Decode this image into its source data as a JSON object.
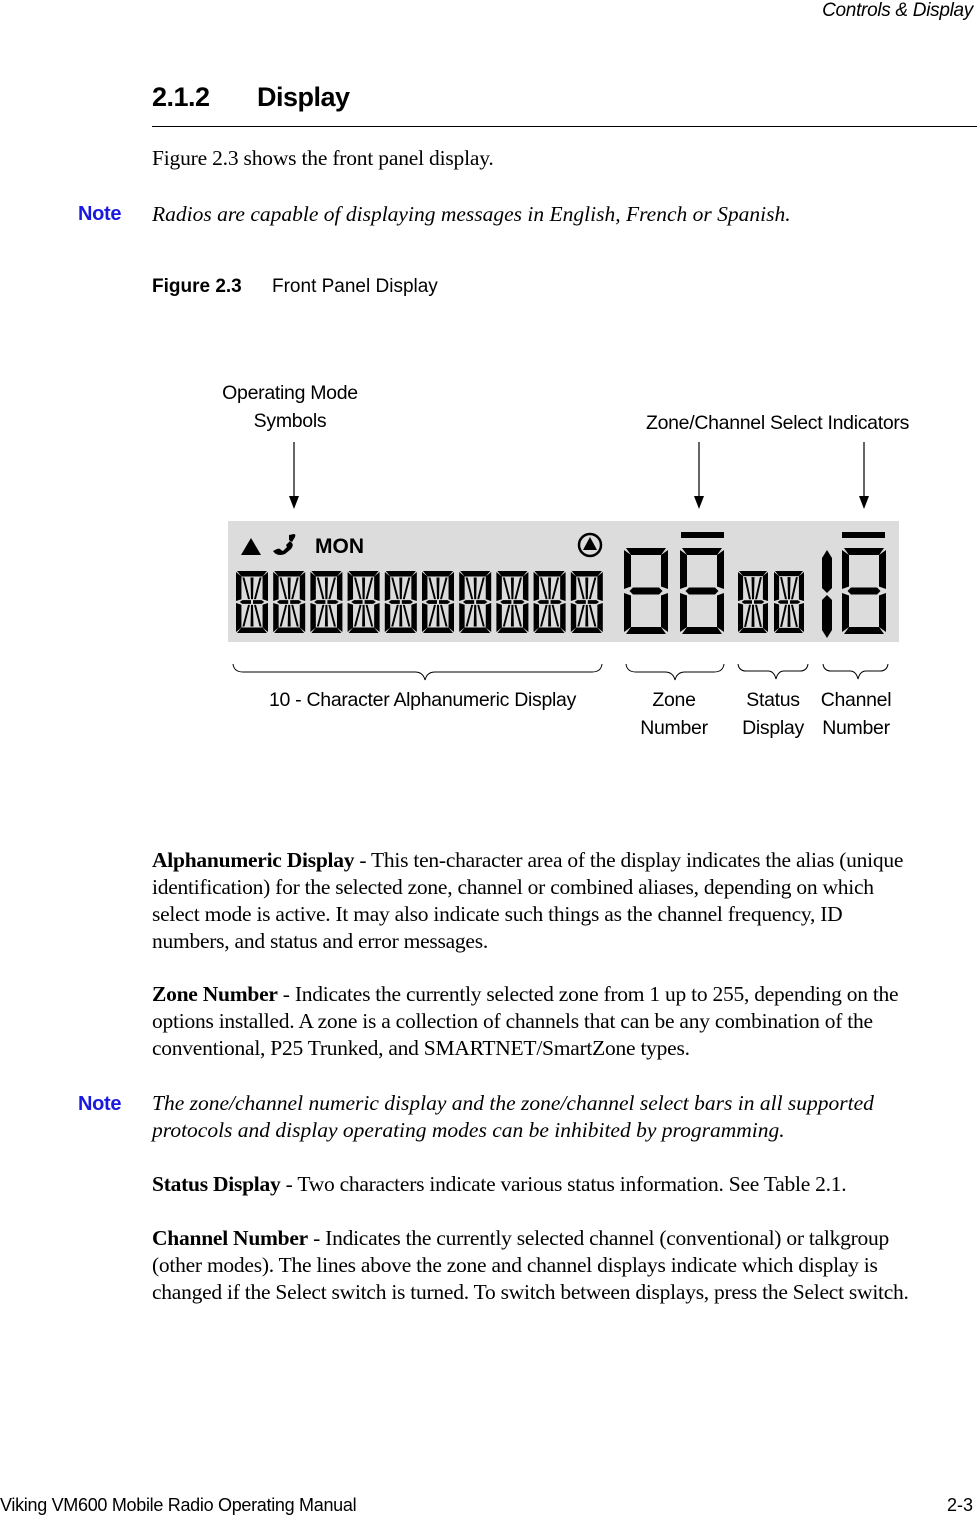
{
  "header": {
    "running_title": "Controls & Display"
  },
  "section": {
    "number": "2.1.2",
    "title": "Display"
  },
  "intro": "Figure 2.3 shows the front panel display.",
  "notes": [
    {
      "label": "Note",
      "text": "Radios are capable of displaying messages in English, French or Spanish."
    },
    {
      "label": "Note",
      "text_lines": [
        "The zone/channel numeric display and the zone/channel select bars in all supported",
        "protocols and display operating modes can be inhibited by programming."
      ]
    }
  ],
  "figure": {
    "number": "Figure 2.3",
    "title": "Front Panel Display",
    "callouts_top": {
      "operating_mode": [
        "Operating Mode",
        "Symbols"
      ],
      "zone_channel_select": "Zone/Channel Select Indicators"
    },
    "lcd": {
      "symbols": [
        {
          "name": "triangle-up-icon",
          "glyph": "▲"
        },
        {
          "name": "phone-icon",
          "glyph": "phone"
        },
        {
          "name": "mon-text",
          "glyph": "MON"
        },
        {
          "name": "circle-triangle-icon",
          "glyph": "circle-triangle"
        }
      ],
      "alphanumeric_chars": 10,
      "zone_digits": 2,
      "status_chars": 2,
      "channel_digits": "1 + full digit",
      "select_bars": [
        "zone",
        "channel"
      ],
      "background_color": "#dcdcdc",
      "segment_color": "#000000"
    },
    "callouts_bottom": {
      "alphanumeric": "10 - Character Alphanumeric Display",
      "zone": [
        "Zone",
        "Number"
      ],
      "status": [
        "Status",
        "Display"
      ],
      "channel": [
        "Channel",
        "Number"
      ]
    }
  },
  "paragraphs": {
    "alphanumeric": {
      "term": "Alphanumeric Display",
      "sep": " - ",
      "lines": [
        "This ten-character area of the display indicates the alias (unique",
        "identification) for the selected zone, channel or combined aliases, depending on which",
        "select mode is active. It may also indicate such things as the channel frequency, ID",
        "numbers, and status and error messages."
      ]
    },
    "zone": {
      "term": "Zone Number",
      "sep": " - ",
      "lines": [
        "Indicates the currently selected zone from 1 up to 255, depending on the",
        "options installed. A zone is a collection of channels that can be any combination of the",
        "conventional, P25 Trunked, and SMARTNET/SmartZone types."
      ]
    },
    "status": {
      "term": "Status Display",
      "sep": " - ",
      "lines": [
        "Two characters indicate various status information. See Table 2.1."
      ]
    },
    "channel": {
      "term": "Channel Number",
      "sep": " - ",
      "lines": [
        "Indicates the currently selected channel (conventional) or talkgroup",
        "(other modes). The lines above the zone and channel displays indicate which display is",
        "changed if the Select switch is turned. To switch between displays, press the Select switch."
      ]
    }
  },
  "footer": {
    "manual_title": "Viking VM600 Mobile Radio Operating Manual",
    "page_number": "2-3"
  }
}
